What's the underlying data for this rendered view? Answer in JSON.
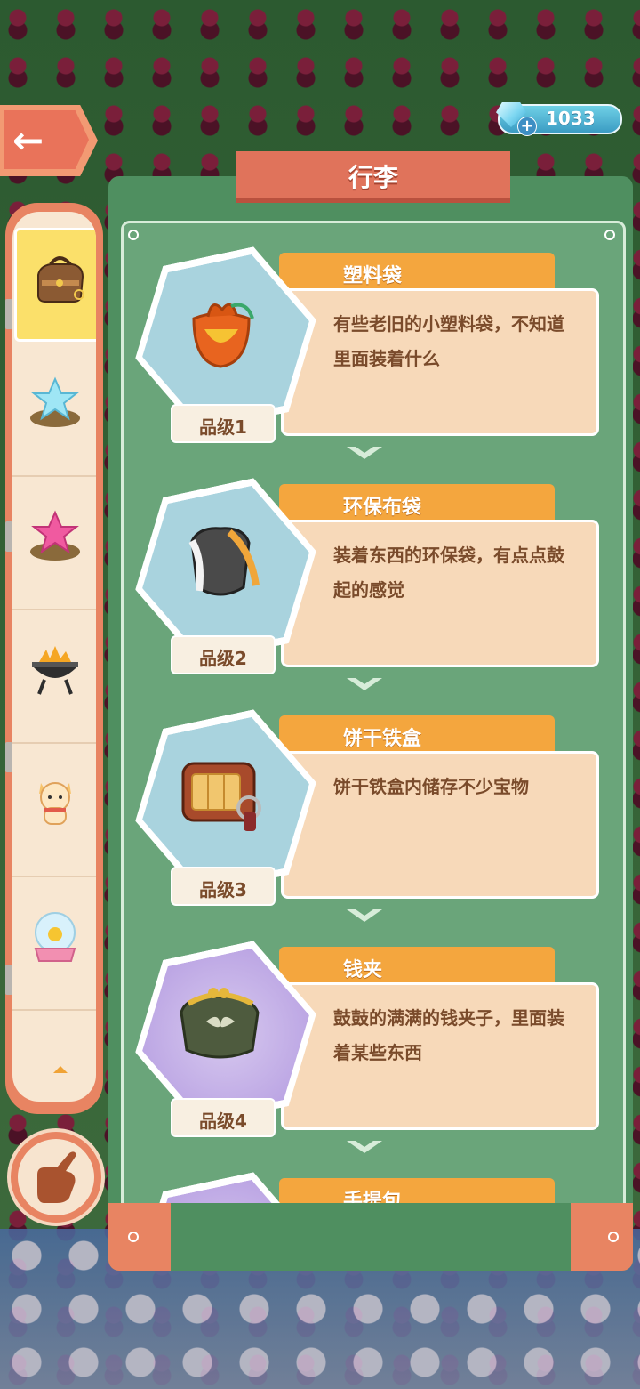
{
  "header": {
    "back_label": "←",
    "title": "行李",
    "currency": {
      "value": "1033",
      "icon": "gem-icon",
      "add_icon": "plus-icon"
    }
  },
  "sidebar": {
    "tabs": [
      {
        "name": "luggage",
        "icon": "luggage-bag-icon",
        "active": true
      },
      {
        "name": "blue-star",
        "icon": "blue-star-icon",
        "active": false
      },
      {
        "name": "pink-star",
        "icon": "pink-star-icon",
        "active": false
      },
      {
        "name": "grill",
        "icon": "grill-icon",
        "active": false
      },
      {
        "name": "cat",
        "icon": "cat-figure-icon",
        "active": false
      },
      {
        "name": "snow-globe",
        "icon": "snow-globe-icon",
        "active": false
      }
    ]
  },
  "items": [
    {
      "name": "塑料袋",
      "desc": "有些老旧的小塑料袋，不知道里面装着什么",
      "grade": "品级1",
      "icon": "plastic-bag-icon"
    },
    {
      "name": "环保布袋",
      "desc": "装着东西的环保袋，有点点鼓起的感觉",
      "grade": "品级2",
      "icon": "cloth-bag-icon"
    },
    {
      "name": "饼干铁盒",
      "desc": "饼干铁盒内储存不少宝物",
      "grade": "品级3",
      "icon": "cookie-tin-icon"
    },
    {
      "name": "钱夹",
      "desc": "鼓鼓的满满的钱夹子，里面装着某些东西",
      "grade": "品级4",
      "icon": "coin-purse-icon"
    },
    {
      "name": "手提包",
      "desc": "",
      "grade": "",
      "icon": "handbag-icon"
    }
  ],
  "colors": {
    "panel": "#4f8f60",
    "accent": "#e88462",
    "name_bar": "#f4a63e",
    "desc_bg": "#f7d9b9",
    "text": "#7a4b2b"
  }
}
